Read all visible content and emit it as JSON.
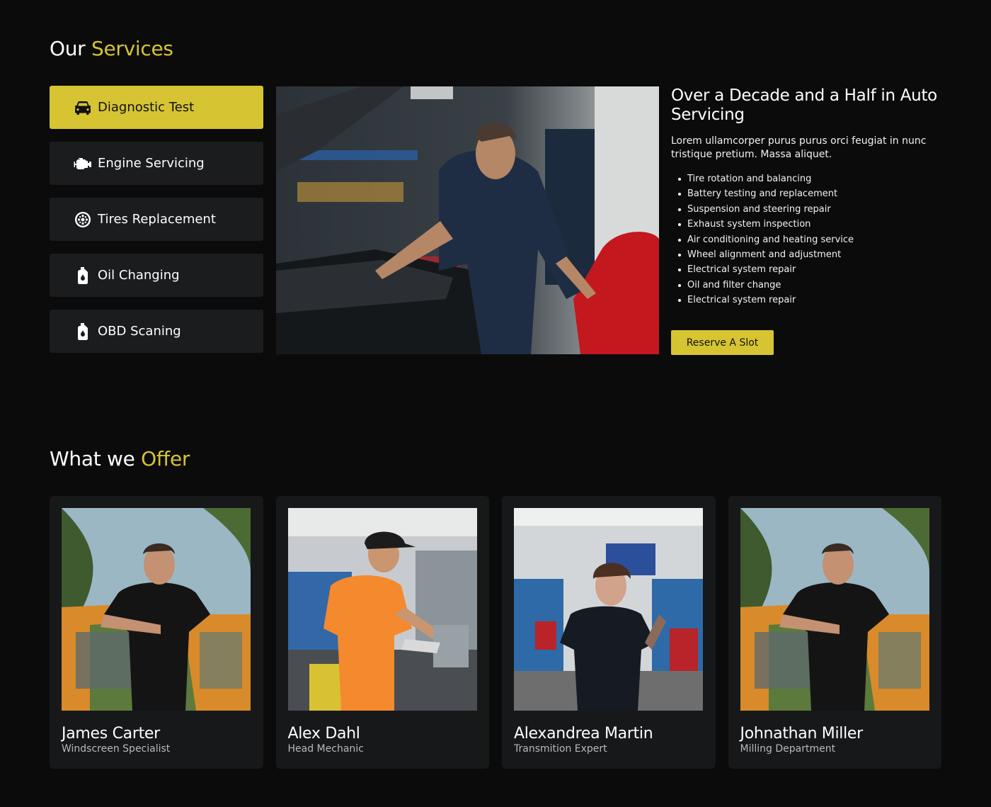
{
  "services_section": {
    "title_plain": "Our",
    "title_accent": "Services",
    "items": [
      {
        "label": "Diagnostic Test",
        "icon": "car-icon",
        "active": true
      },
      {
        "label": "Engine Servicing",
        "icon": "engine-icon",
        "active": false
      },
      {
        "label": "Tires Replacement",
        "icon": "tire-icon",
        "active": false
      },
      {
        "label": "Oil Changing",
        "icon": "oil-can-icon",
        "active": false
      },
      {
        "label": "OBD Scaning",
        "icon": "oil-can-icon",
        "active": false
      }
    ],
    "detail": {
      "heading": "Over a Decade and a Half in Auto Servicing",
      "description": "Lorem ullamcorper purus purus orci feugiat in nunc tristique pretium. Massa aliquet.",
      "features": [
        "Tire rotation and balancing",
        "Battery testing and replacement",
        "Suspension and steering repair",
        "Exhaust system inspection",
        "Air conditioning and heating service",
        "Wheel alignment and adjustment",
        "Electrical system repair",
        "Oil and filter change",
        "Electrical system repair"
      ],
      "button_label": "Reserve A Slot"
    }
  },
  "offer_section": {
    "title_plain": "What we",
    "title_accent": "Offer",
    "team": [
      {
        "name": "James Carter",
        "role": "Windscreen Specialist"
      },
      {
        "name": "Alex Dahl",
        "role": "Head Mechanic"
      },
      {
        "name": "Alexandrea Martin",
        "role": "Transmition Expert"
      },
      {
        "name": "Johnathan Miller",
        "role": "Milling Department"
      }
    ]
  },
  "colors": {
    "background": "#0b0b0c",
    "accent": "#d6c433",
    "card": "#1b1c1e"
  }
}
